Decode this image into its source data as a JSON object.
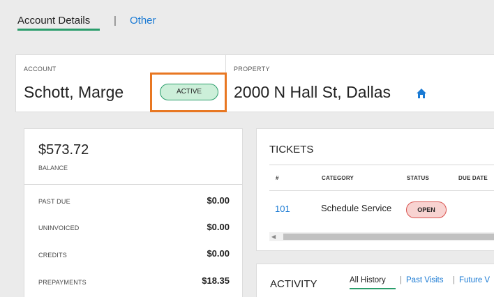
{
  "nav": {
    "tabs": [
      {
        "label": "Account Details",
        "active": true
      },
      {
        "label": "Other",
        "active": false
      }
    ],
    "separator": "|"
  },
  "account": {
    "label": "ACCOUNT",
    "name": "Schott, Marge",
    "status": "ACTIVE"
  },
  "property": {
    "label": "PROPERTY",
    "address": "2000 N Hall St, Dallas",
    "icon": "home-icon"
  },
  "balance": {
    "amount": "$573.72",
    "label": "BALANCE",
    "rows": [
      {
        "label": "PAST DUE",
        "value": "$0.00"
      },
      {
        "label": "UNINVOICED",
        "value": "$0.00"
      },
      {
        "label": "CREDITS",
        "value": "$0.00"
      },
      {
        "label": "PREPAYMENTS",
        "value": "$18.35"
      }
    ]
  },
  "tickets": {
    "title": "TICKETS",
    "columns": [
      "#",
      "CATEGORY",
      "STATUS",
      "DUE DATE"
    ],
    "rows": [
      {
        "number": "101",
        "category": "Schedule Service",
        "status": "OPEN"
      }
    ]
  },
  "activity": {
    "title": "ACTIVITY",
    "tabs": [
      "All History",
      "Past Visits",
      "Future V"
    ],
    "separator": "|"
  },
  "colors": {
    "accent_green": "#2a9d6b",
    "link_blue": "#1a7ad4",
    "highlight_orange": "#e87722",
    "open_red": "#d9534f"
  }
}
